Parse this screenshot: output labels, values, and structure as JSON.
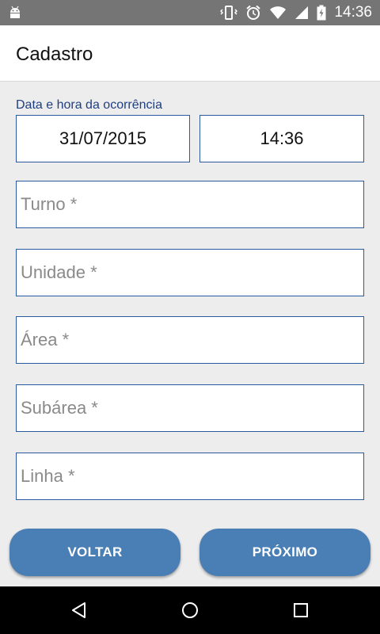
{
  "status_bar": {
    "time": "14:36"
  },
  "app_bar": {
    "title": "Cadastro"
  },
  "form": {
    "datetime_label": "Data e hora da ocorrência",
    "date_value": "31/07/2015",
    "time_value": "14:36",
    "fields": [
      {
        "placeholder": "Turno *"
      },
      {
        "placeholder": "Unidade *"
      },
      {
        "placeholder": "Área *"
      },
      {
        "placeholder": "Subárea *"
      },
      {
        "placeholder": "Linha *"
      }
    ]
  },
  "buttons": {
    "back_label": "VOLTAR",
    "next_label": "PRÓXIMO"
  },
  "colors": {
    "accent": "#4a7fb5",
    "border": "#2b5aa0",
    "label": "#1f3f82",
    "status_bar": "#757575"
  }
}
